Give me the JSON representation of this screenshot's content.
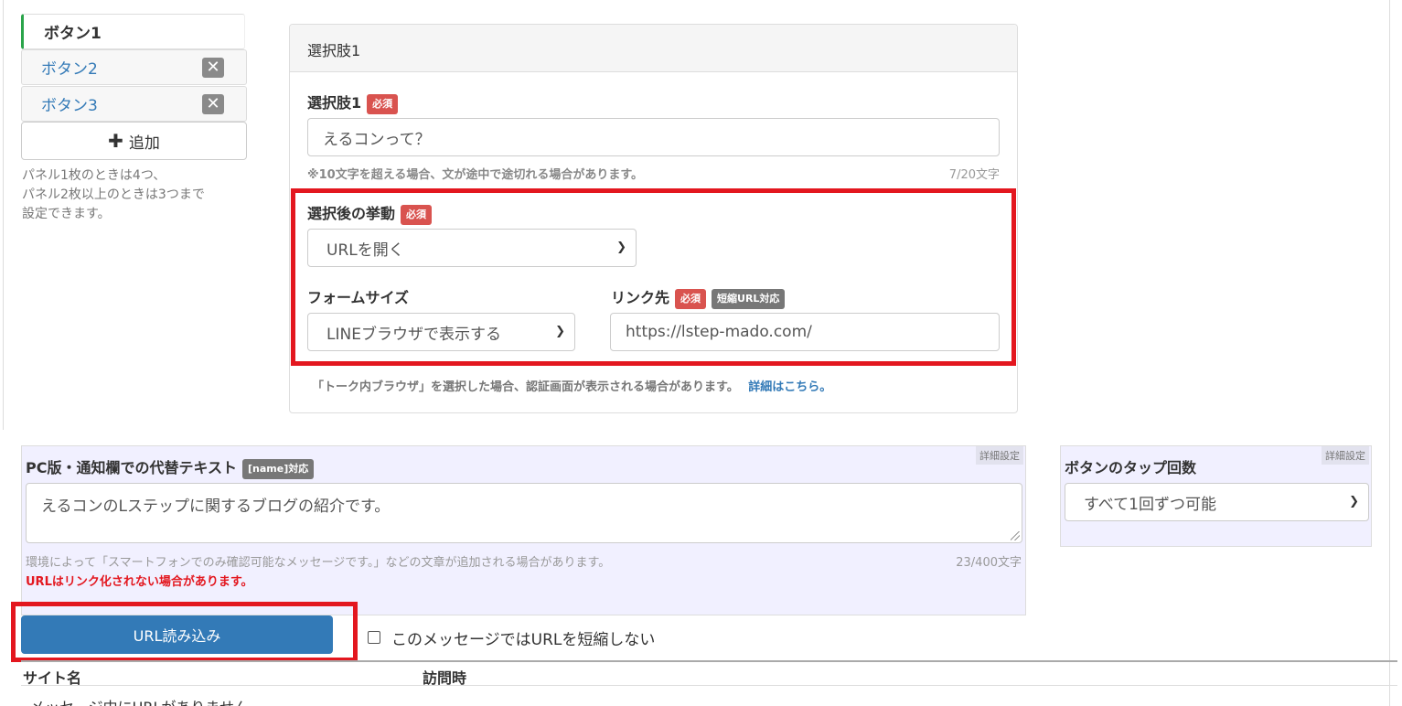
{
  "tabs": [
    {
      "label": "ボタン1",
      "active": true
    },
    {
      "label": "ボタン2",
      "active": false
    },
    {
      "label": "ボタン3",
      "active": false
    }
  ],
  "add_button": {
    "label": "追加",
    "icon": "plus-icon"
  },
  "left_note": [
    "パネル1枚のときは4つ、",
    "パネル2枚以上のときは3つまで",
    "設定できます。"
  ],
  "panel": {
    "header": "選択肢1",
    "choice_label": "選択肢1",
    "required_badge": "必須",
    "choice_value": "えるコンって？",
    "choice_note": "※10文字を超える場合、文が途中で途切れる場合があります。",
    "choice_counter": "7/20文字",
    "action_label": "選択後の挙動",
    "action_value": "URLを開く",
    "form_size_label": "フォームサイズ",
    "form_size_value": "LINEブラウザで表示する",
    "link_label": "リンク先",
    "short_url_badge": "短縮URL対応",
    "link_value": "https://lstep-mado.com/",
    "browser_note": "「トーク内ブラウザ」を選択した場合、認証画面が表示される場合があります。",
    "detail_link": "詳細はこちら。"
  },
  "alt_text": {
    "label": "PC版・通知欄での代替テキスト",
    "name_badge": "[name]対応",
    "detail_tag": "詳細設定",
    "value": "えるコンのLステップに関するブログの紹介です。",
    "note": "環境によって「スマートフォンでのみ確認可能なメッセージです。」などの文章が追加される場合があります。",
    "counter": "23/400文字",
    "warning": "URLはリンク化されない場合があります。"
  },
  "tap_count": {
    "label": "ボタンのタップ回数",
    "detail_tag": "詳細設定",
    "value": "すべて1回ずつ可能"
  },
  "url_load_button": "URL読み込み",
  "no_shorten_checkbox": "このメッセージではURLを短縮しない",
  "table": {
    "headers": [
      "サイト名",
      "訪問時"
    ],
    "empty_row": "メッセージ中にURLがありません"
  },
  "colors": {
    "accent": "#337ab7",
    "required": "#d9534f",
    "highlight": "#e3171f",
    "active_tab": "#2aa44a"
  }
}
